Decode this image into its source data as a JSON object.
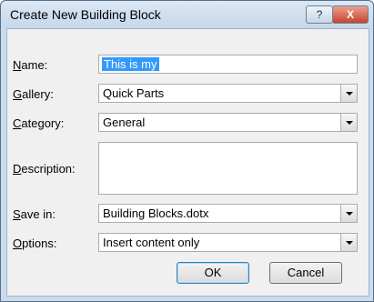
{
  "window": {
    "title": "Create New Building Block",
    "help_glyph": "?",
    "close_glyph": "X"
  },
  "form": {
    "name_label_u": "N",
    "name_label_rest": "ame:",
    "name_value": "This is my",
    "gallery_label_u": "G",
    "gallery_label_rest": "allery:",
    "gallery_value": "Quick Parts",
    "category_label_u": "C",
    "category_label_rest": "ategory:",
    "category_value": "General",
    "description_label_u": "D",
    "description_label_rest": "escription:",
    "description_value": "",
    "savein_label_u": "S",
    "savein_label_rest": "ave in:",
    "savein_value": "Building Blocks.dotx",
    "options_label_u": "O",
    "options_label_rest": "ptions:",
    "options_value": "Insert content only"
  },
  "buttons": {
    "ok": "OK",
    "cancel": "Cancel"
  }
}
